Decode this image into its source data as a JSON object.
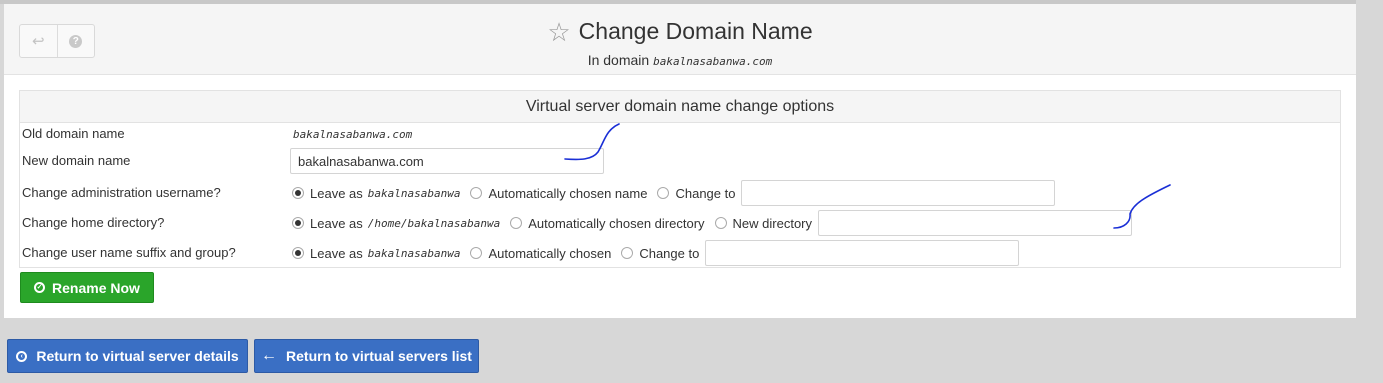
{
  "header": {
    "title": "Change Domain Name",
    "subtitle_prefix": "In domain",
    "domain": "bakalnasabanwa.com",
    "back_icon": "undo-arrow-icon",
    "help_icon": "help-icon",
    "star_icon": "star-outline-icon"
  },
  "options": {
    "heading": "Virtual server domain name change options",
    "old_domain_label": "Old domain name",
    "old_domain_value": "bakalnasabanwa.com",
    "new_domain_label": "New domain name",
    "new_domain_value": "bakalnasabanwa.com",
    "admin_user": {
      "label": "Change administration username?",
      "leave_as": "Leave as",
      "leave_value": "bakalnasabanwa",
      "auto": "Automatically chosen name",
      "change_to": "Change to",
      "change_value": ""
    },
    "home_dir": {
      "label": "Change home directory?",
      "leave_as": "Leave as",
      "leave_value": "/home/bakalnasabanwa",
      "auto": "Automatically chosen directory",
      "new_dir": "New directory",
      "new_value": ""
    },
    "suffix_group": {
      "label": "Change user name suffix and group?",
      "leave_as": "Leave as",
      "leave_value": "bakalnasabanwa",
      "auto": "Automatically chosen",
      "change_to": "Change to",
      "change_value": ""
    }
  },
  "actions": {
    "rename_label": "Rename Now",
    "return_details_label": "Return to virtual server details",
    "return_list_label": "Return to virtual servers list"
  },
  "colors": {
    "green": "#2aa52a",
    "blue": "#3a6fc4",
    "annotation": "#1a2fd6"
  }
}
